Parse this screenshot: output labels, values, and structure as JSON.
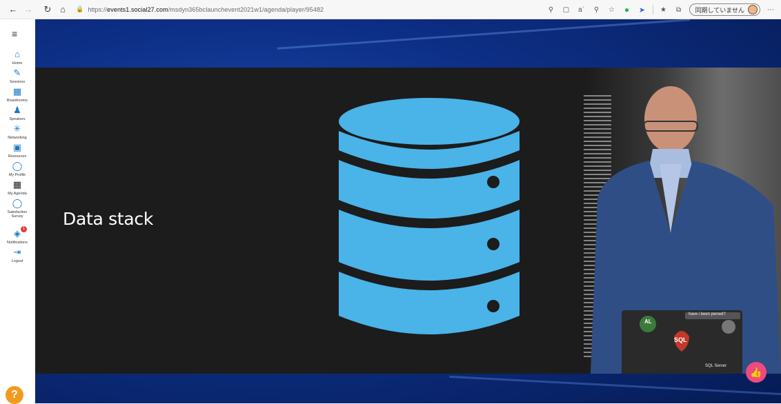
{
  "browser": {
    "url_scheme": "https://",
    "url_host": "events1.social27.com",
    "url_path": "/msdyn365bclaunchevent2021w1/agenda/player/95482",
    "profile_label": "同期していません"
  },
  "sidebar": {
    "items": [
      {
        "label": "Home",
        "icon": "home-icon"
      },
      {
        "label": "Sessions",
        "icon": "pencil-icon"
      },
      {
        "label": "Boardrooms",
        "icon": "boardroom-icon"
      },
      {
        "label": "Speakers",
        "icon": "speaker-icon"
      },
      {
        "label": "Networking",
        "icon": "networking-icon"
      },
      {
        "label": "Resources",
        "icon": "resources-icon"
      },
      {
        "label": "My Profile",
        "icon": "profile-icon"
      },
      {
        "label": "My Agenda",
        "icon": "agenda-icon"
      },
      {
        "label": "Satisfaction Survey",
        "icon": "survey-icon"
      },
      {
        "label": "Notifications",
        "icon": "bell-icon",
        "badge": "1"
      },
      {
        "label": "Logout",
        "icon": "logout-icon"
      }
    ],
    "help": "?"
  },
  "slide": {
    "title": "Data stack"
  },
  "video": {
    "laptop_sticker_1": "SQL",
    "laptop_sticker_2": "AL",
    "laptop_caption": "have i been pwned?",
    "sql_server": "SQL Server"
  },
  "colors": {
    "accent": "#1a78c2",
    "cylinder": "#4ab3e8",
    "like": "#ee4a7f",
    "help": "#f29a1f"
  }
}
